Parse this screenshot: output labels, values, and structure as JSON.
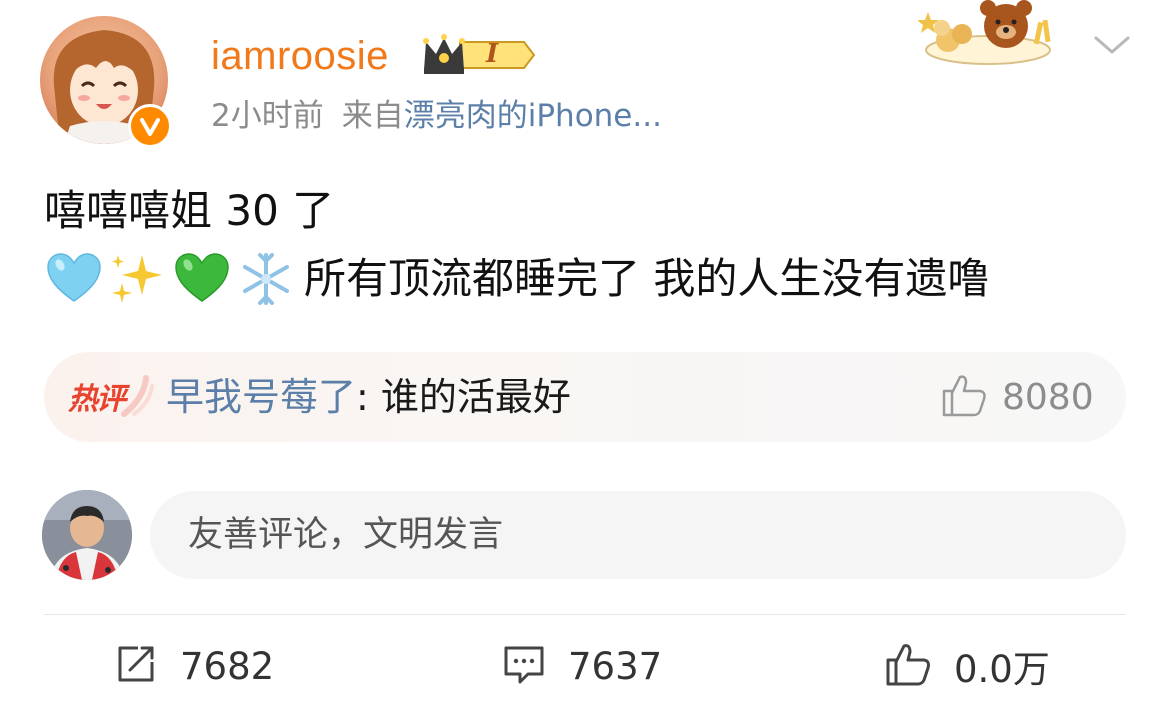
{
  "post": {
    "username": "iamroosie",
    "vip_level": "I",
    "time": "2小时前",
    "from_label": "来自",
    "device": "漂亮肉的iPhone...",
    "line1": "嘻嘻嘻姐 30 了",
    "line2_emojis": [
      "light-blue-heart-emoji",
      "sparkles-emoji",
      "green-heart-emoji",
      "snowflake-emoji"
    ],
    "line2_text": "所有顶流都睡完了 我的人生没有遗噜"
  },
  "hot_comment": {
    "tag": "热评",
    "commenter": "早我号莓了",
    "text": ": 谁的活最好",
    "likes": "8080"
  },
  "comment_box": {
    "placeholder": "友善评论，文明发言"
  },
  "actions": {
    "repost_count": "7682",
    "comment_count": "7637",
    "like_count": "0.0万"
  },
  "colors": {
    "username": "#f07a1b",
    "device_link": "#5b7fa8",
    "hot_tag": "#e8432e",
    "verified_badge": "#ff8a00"
  }
}
